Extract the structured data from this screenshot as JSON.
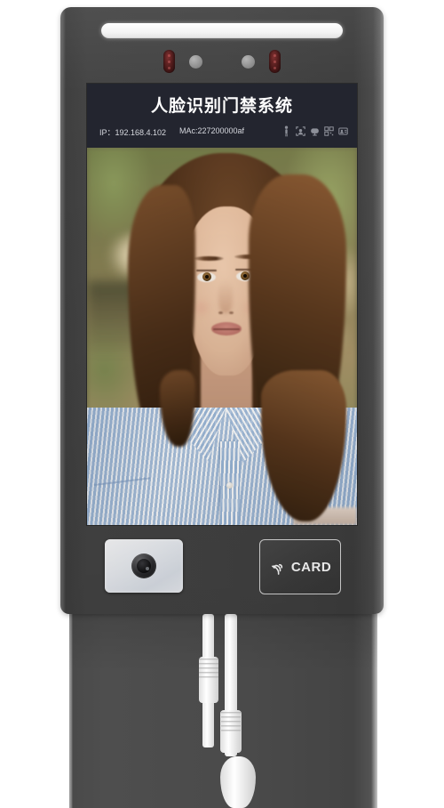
{
  "device": {
    "name": "face-recognition-access-control-terminal",
    "bezel_color": "#434343",
    "stand_color": "#4a4a4a"
  },
  "screen": {
    "header": {
      "title": "人脸识别门禁系统",
      "background_color": "#23252f",
      "title_color": "#ffffff",
      "ip_label": "IP：192.168.4.102",
      "mac_label": "MAc:227200000af",
      "status_icons": [
        {
          "name": "person-standing-icon",
          "glyph": "person"
        },
        {
          "name": "face-detect-icon",
          "glyph": "face"
        },
        {
          "name": "network-icon",
          "glyph": "network"
        },
        {
          "name": "qr-code-icon",
          "glyph": "qr"
        },
        {
          "name": "id-card-icon",
          "glyph": "card"
        }
      ]
    },
    "feed": {
      "label": "live-camera-preview",
      "subject": "woman-facing-camera",
      "shirt_color": "#bdd0e6",
      "hair_color": "#5a381d",
      "background": "blurred-indoor-green"
    }
  },
  "top_panel": {
    "led_bar": "white-fill-light-bar",
    "ir_leds": 2,
    "sensors": 2
  },
  "bottom_panel": {
    "camera_module": {
      "name": "secondary-ir-camera",
      "body_color": "#eef1f6",
      "lens_color": "#141416"
    },
    "card_reader": {
      "label": "CARD",
      "icon": "rfid-wave-icon",
      "border_color": "#d9d9d9"
    }
  },
  "cables": {
    "count": 2,
    "color": "#ffffff",
    "description": "power-and-network-cables"
  }
}
